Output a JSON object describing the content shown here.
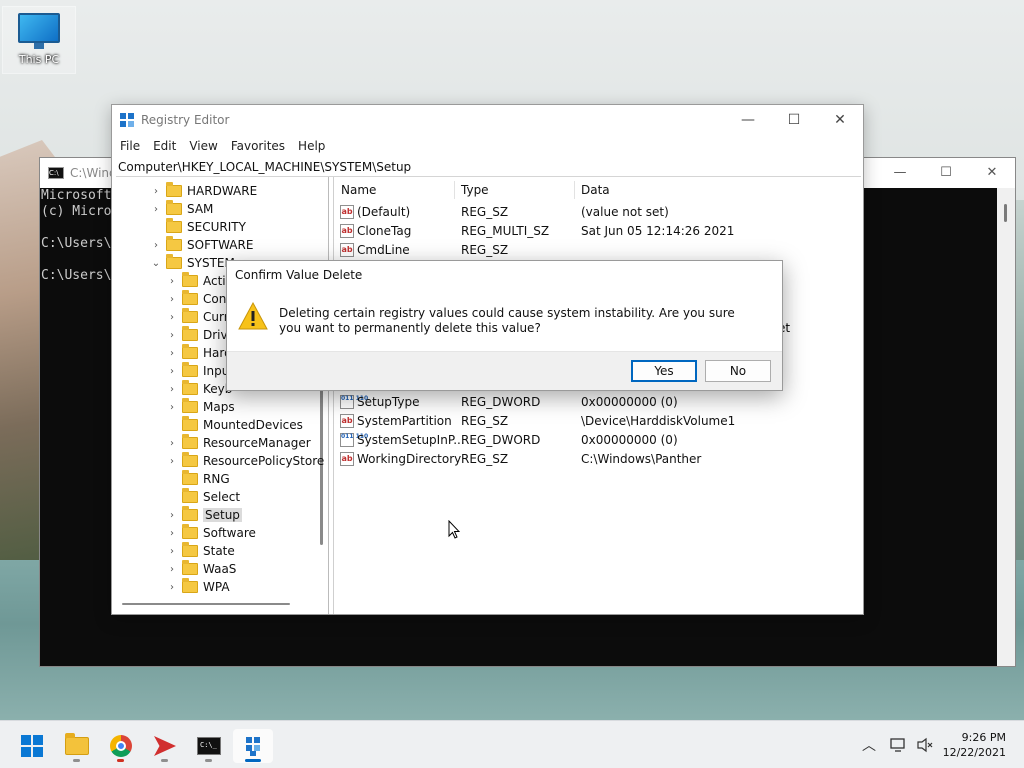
{
  "desktop": {
    "icon_label": "This PC"
  },
  "console": {
    "title": "C:\\Wind",
    "lines": [
      "Microsoft",
      "(c) Micro",
      "",
      "C:\\Users\\",
      "",
      "C:\\Users\\"
    ]
  },
  "regedit": {
    "title": "Registry Editor",
    "menu": [
      "File",
      "Edit",
      "View",
      "Favorites",
      "Help"
    ],
    "address": "Computer\\HKEY_LOCAL_MACHINE\\SYSTEM\\Setup",
    "tree": [
      {
        "label": "HARDWARE",
        "level": 1,
        "expander": "closed"
      },
      {
        "label": "SAM",
        "level": 1,
        "expander": "closed"
      },
      {
        "label": "SECURITY",
        "level": 1,
        "expander": "none"
      },
      {
        "label": "SOFTWARE",
        "level": 1,
        "expander": "closed"
      },
      {
        "label": "SYSTEM",
        "level": 1,
        "expander": "open"
      },
      {
        "label": "Activ",
        "level": 2,
        "expander": "closed"
      },
      {
        "label": "Cont",
        "level": 2,
        "expander": "closed"
      },
      {
        "label": "Curr",
        "level": 2,
        "expander": "closed"
      },
      {
        "label": "Drive",
        "level": 2,
        "expander": "closed"
      },
      {
        "label": "Hard",
        "level": 2,
        "expander": "closed"
      },
      {
        "label": "Inpu",
        "level": 2,
        "expander": "closed"
      },
      {
        "label": "Keyb",
        "level": 2,
        "expander": "closed"
      },
      {
        "label": "Maps",
        "level": 2,
        "expander": "closed"
      },
      {
        "label": "MountedDevices",
        "level": 2,
        "expander": "none"
      },
      {
        "label": "ResourceManager",
        "level": 2,
        "expander": "closed"
      },
      {
        "label": "ResourcePolicyStore",
        "level": 2,
        "expander": "closed"
      },
      {
        "label": "RNG",
        "level": 2,
        "expander": "none"
      },
      {
        "label": "Select",
        "level": 2,
        "expander": "none"
      },
      {
        "label": "Setup",
        "level": 2,
        "expander": "closed",
        "selected": true
      },
      {
        "label": "Software",
        "level": 2,
        "expander": "closed"
      },
      {
        "label": "State",
        "level": 2,
        "expander": "closed"
      },
      {
        "label": "WaaS",
        "level": 2,
        "expander": "closed"
      },
      {
        "label": "WPA",
        "level": 2,
        "expander": "closed"
      }
    ],
    "columns": [
      "Name",
      "Type",
      "Data"
    ],
    "values_top": [
      {
        "icon": "ab",
        "name": "(Default)",
        "type": "REG_SZ",
        "data": "(value not set)"
      },
      {
        "icon": "ab",
        "name": "CloneTag",
        "type": "REG_MULTI_SZ",
        "data": "Sat Jun 05 12:14:26 2021"
      },
      {
        "icon": "ab",
        "name": "CmdLine",
        "type": "REG_SZ",
        "data": ""
      }
    ],
    "values_bottom": [
      {
        "icon": "bin",
        "name": "SetupType",
        "type": "REG_DWORD",
        "data": "0x00000000 (0)"
      },
      {
        "icon": "ab",
        "name": "SystemPartition",
        "type": "REG_SZ",
        "data": "\\Device\\HarddiskVolume1"
      },
      {
        "icon": "bin",
        "name": "SystemSetupInP...",
        "type": "REG_DWORD",
        "data": "0x00000000 (0)"
      },
      {
        "icon": "ab",
        "name": "WorkingDirectory",
        "type": "REG_SZ",
        "data": "C:\\Windows\\Panther"
      }
    ],
    "obscured_fragment": "et"
  },
  "dialog": {
    "title": "Confirm Value Delete",
    "message": "Deleting certain registry values could cause system instability. Are you sure you want to permanently delete this value?",
    "yes_label": "Yes",
    "no_label": "No"
  },
  "taskbar": {
    "apps": [
      "start-icon",
      "file-explorer-icon",
      "chrome-icon",
      "send-icon",
      "terminal-icon",
      "registry-editor-icon"
    ],
    "time": "9:26 PM",
    "date": "12/22/2021"
  }
}
